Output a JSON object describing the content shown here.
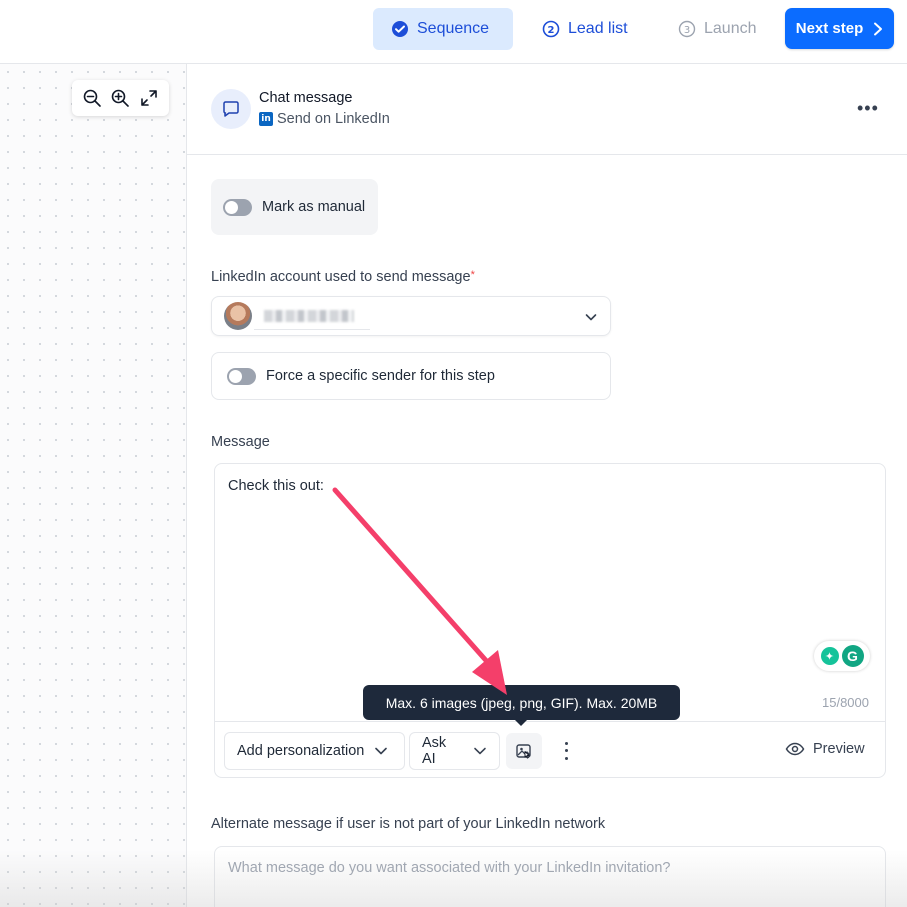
{
  "topbar": {
    "steps": [
      {
        "label": "Sequence",
        "state": "active"
      },
      {
        "label": "Lead list",
        "state": "done"
      },
      {
        "label": "Launch",
        "state": "pending"
      }
    ],
    "next_button": "Next step"
  },
  "canvas": {
    "zoom_controls": [
      "zoom-out-icon",
      "zoom-in-icon",
      "fit-view-icon"
    ]
  },
  "panel": {
    "title": "Chat message",
    "subtitle": "Send on LinkedIn",
    "mark_manual_label": "Mark as manual",
    "mark_manual_on": false,
    "account_label": "LinkedIn account used to send message",
    "account_required_mark": "*",
    "force_sender_label": "Force a specific sender for this step",
    "force_sender_on": false,
    "message_label": "Message",
    "message_text": "Check this out:",
    "char_counter": "15/8000",
    "toolbar": {
      "personalization": "Add personalization",
      "ask_ai": "Ask AI",
      "preview": "Preview"
    },
    "tooltip": "Max. 6 images (jpeg, png, GIF). Max. 20MB",
    "alt_label": "Alternate message if user is not part of your LinkedIn network",
    "alt_placeholder": "What message do you want associated with your LinkedIn invitation?"
  },
  "colors": {
    "primary": "#0b6cff",
    "active_step_bg": "#dbeafe",
    "tooltip_bg": "#1e293b",
    "annotation_arrow": "#f43f6a",
    "linkedin": "#0a66c2",
    "grammarly": "#15c39a"
  }
}
